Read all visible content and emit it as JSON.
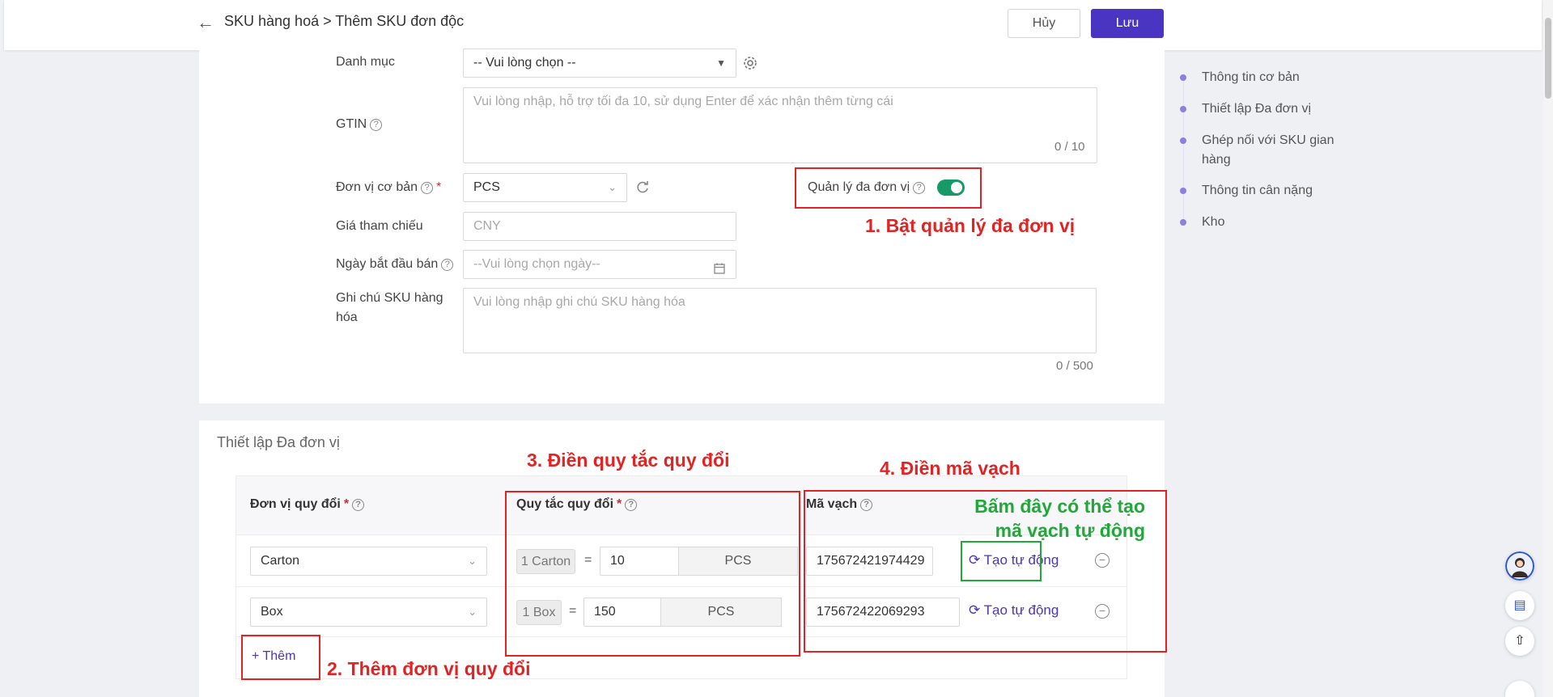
{
  "header": {
    "breadcrumb": "SKU hàng hoá > Thêm SKU đơn độc",
    "cancel_label": "Hủy",
    "save_label": "Lưu"
  },
  "form": {
    "category_label": "Danh mục",
    "category_value": "-- Vui lòng chọn --",
    "gtin_label": "GTIN",
    "gtin_placeholder": "Vui lòng nhập, hỗ trợ tối đa 10, sử dụng Enter để xác nhận thêm từng cái",
    "gtin_counter": "0 / 10",
    "base_unit_label": "Đơn vị cơ bản",
    "base_unit_value": "PCS",
    "multi_unit_label": "Quản lý đa đơn vị",
    "multi_unit_enabled": true,
    "ref_price_label": "Giá tham chiếu",
    "ref_price_placeholder": "CNY",
    "start_date_label": "Ngày bắt đầu bán",
    "start_date_placeholder": "--Vui lòng chọn ngày--",
    "note_label_line1": "Ghi chú SKU hàng",
    "note_label_line2": "hóa",
    "note_placeholder": "Vui lòng nhập ghi chú SKU hàng hóa",
    "note_counter": "0 / 500"
  },
  "multi_unit": {
    "section_title": "Thiết lập Đa đơn vị",
    "col_unit": "Đơn vị quy đổi",
    "col_rule": "Quy tắc quy đổi",
    "col_barcode": "Mã vạch",
    "rows": [
      {
        "unit": "Carton",
        "rule_tag": "1 Carton",
        "equals": "=",
        "qty": "10",
        "base": "PCS",
        "barcode": "175672421974429",
        "auto_label": "Tạo tự động"
      },
      {
        "unit": "Box",
        "rule_tag": "1 Box",
        "equals": "=",
        "qty": "150",
        "base": "PCS",
        "barcode": "175672422069293",
        "auto_label": "Tạo tự động"
      }
    ],
    "add_label": "Thêm"
  },
  "side_nav": {
    "items": [
      "Thông tin cơ bản",
      "Thiết lập Đa đơn vị",
      "Ghép nối với SKU gian",
      "hàng",
      "Thông tin cân nặng",
      "Kho"
    ]
  },
  "annotations": {
    "step1": "1. Bật quản lý đa đơn vị",
    "step2": "2. Thêm đơn vị quy đổi",
    "step3": "3. Điền quy tắc quy đổi",
    "step4": "4. Điền mã vạch",
    "hint_line1": "Bấm đây có thể tạo",
    "hint_line2": "mã vạch tự động"
  },
  "colors": {
    "primary": "#4a35c2",
    "annotation_red": "#e02424",
    "annotation_green": "#22a83a",
    "toggle_on": "#159a68"
  }
}
